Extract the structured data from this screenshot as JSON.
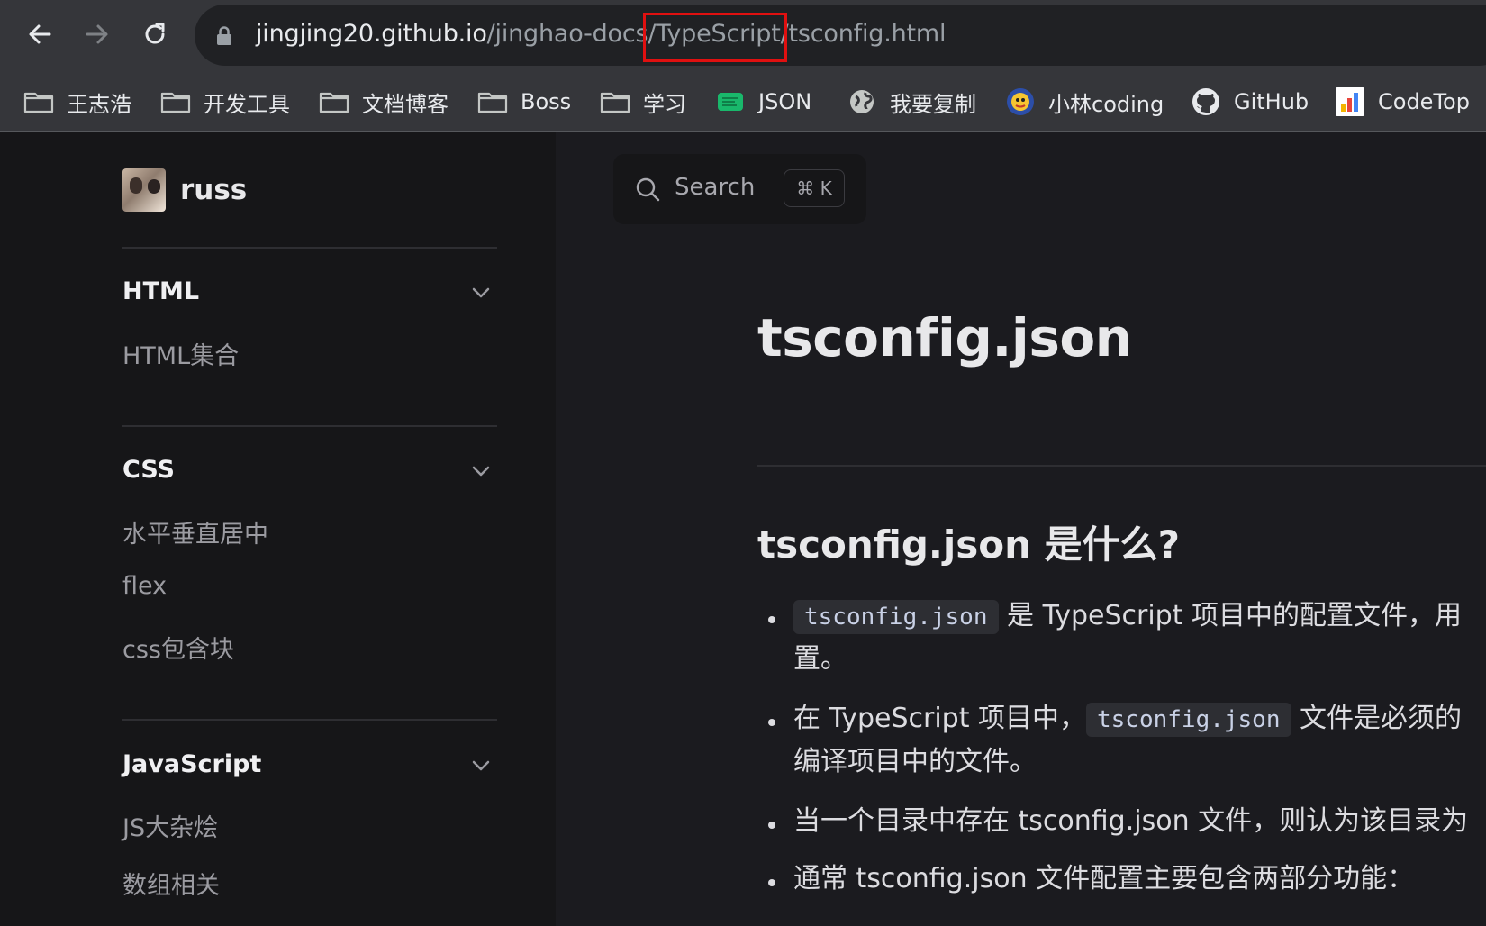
{
  "browser": {
    "url_host": "jingjing20.github.io",
    "url_path_1": "/jinghao-docs",
    "url_path_2": "/TypeScript",
    "url_path_3": "/tsconfig.html",
    "bookmarks": [
      {
        "label": "王志浩",
        "icon": "folder-icon"
      },
      {
        "label": "开发工具",
        "icon": "folder-icon"
      },
      {
        "label": "文档博客",
        "icon": "folder-icon"
      },
      {
        "label": "Boss",
        "icon": "folder-icon"
      },
      {
        "label": "学习",
        "icon": "folder-icon"
      },
      {
        "label": "JSON",
        "icon": "json-icon"
      },
      {
        "label": "我要复制",
        "icon": "globe-icon"
      },
      {
        "label": "小林coding",
        "icon": "xiaolin-logo-icon"
      },
      {
        "label": "GitHub",
        "icon": "github-icon"
      },
      {
        "label": "CodeTop",
        "icon": "codetop-icon"
      }
    ],
    "highlight_color": "#e01010"
  },
  "sidebar": {
    "site_name": "russ",
    "sections": [
      {
        "title": "HTML",
        "items": [
          "HTML集合"
        ]
      },
      {
        "title": "CSS",
        "items": [
          "水平垂直居中",
          "flex",
          "css包含块"
        ]
      },
      {
        "title": "JavaScript",
        "items": [
          "JS大杂烩",
          "数组相关"
        ]
      }
    ]
  },
  "search": {
    "placeholder": "Search",
    "shortcut": "⌘ K"
  },
  "content": {
    "title": "tsconfig.json",
    "heading": "tsconfig.json 是什么?",
    "bullets": [
      {
        "code": "tsconfig.json",
        "text": " 是 TypeScript 项目中的配置文件，用",
        "cont": "置。"
      },
      {
        "pre": "在 TypeScript 项目中，",
        "code": "tsconfig.json",
        "text": " 文件是必须的",
        "cont": "编译项目中的文件。"
      },
      {
        "text": "当一个目录中存在 tsconfig.json 文件，则认为该目录为"
      },
      {
        "text": "通常 tsconfig.json 文件配置主要包含两部分功能："
      }
    ]
  },
  "colors": {
    "sidebar_bg": "#161618",
    "main_bg": "#1b1b1f",
    "chrome_bg": "#35363a"
  }
}
